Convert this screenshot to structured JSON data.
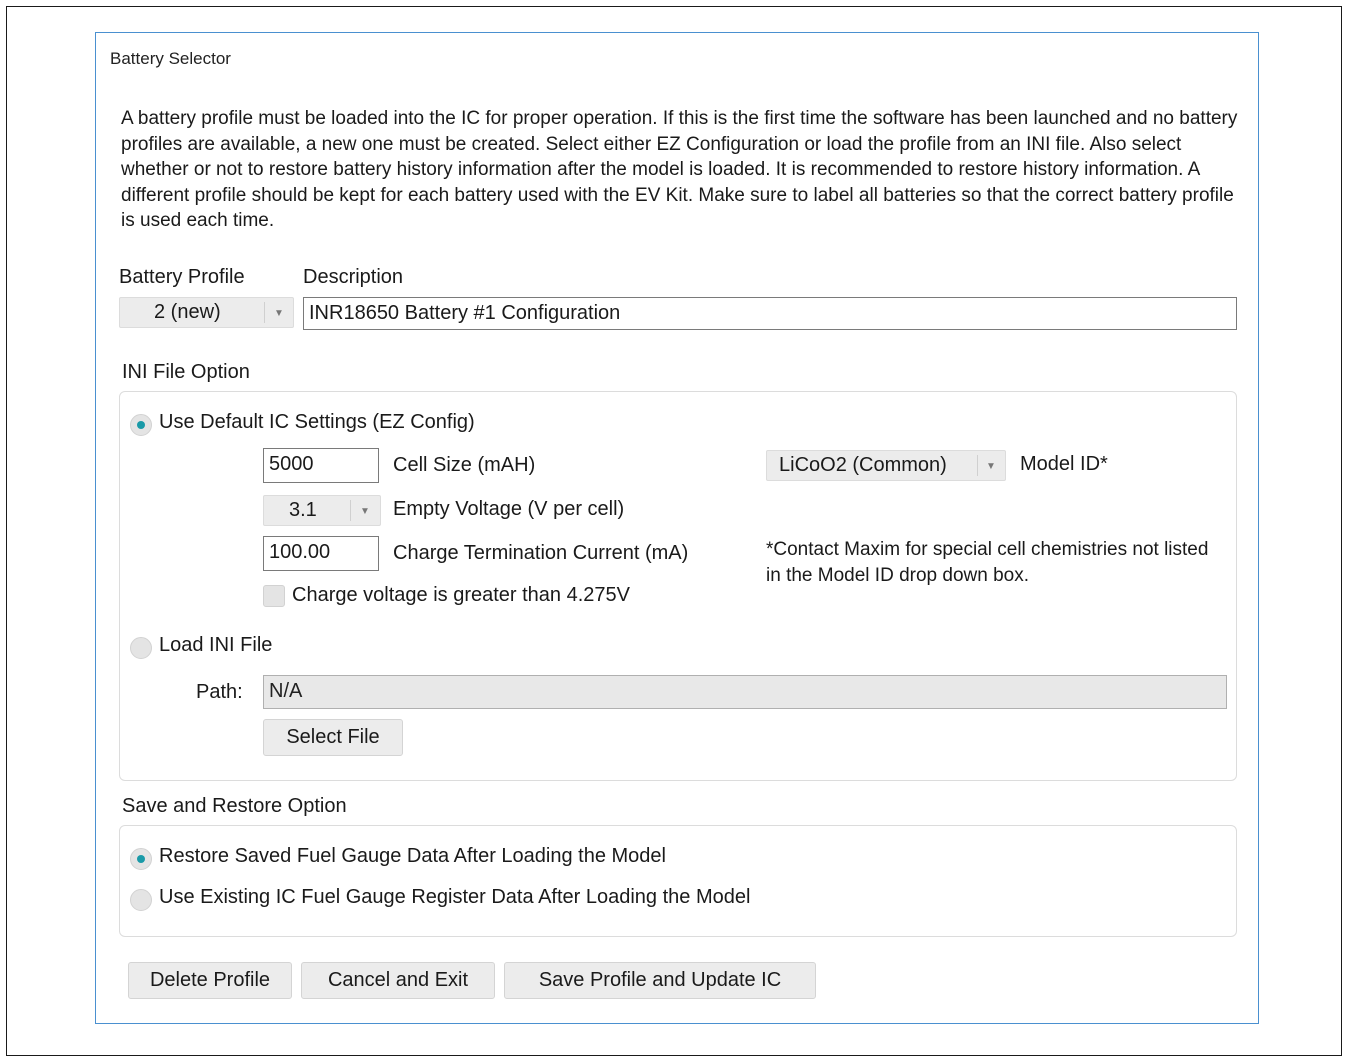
{
  "window": {
    "title": "Battery Selector"
  },
  "intro": "A battery profile must be loaded into the IC for proper operation. If this is the first time the software has been launched and no battery profiles are available, a new one must be created. Select either EZ Configuration or load the profile from an INI file. Also select whether or not to restore battery history information after the model is loaded. It is recommended to restore history information. A different profile should be kept for each battery used with the EV Kit. Make sure to label all batteries so that the correct battery profile is used each time.",
  "profile": {
    "label": "Battery Profile",
    "selected": "2 (new)",
    "description_label": "Description",
    "description_value": "INR18650 Battery #1 Configuration"
  },
  "ini": {
    "section_label": "INI File Option",
    "use_default_label": "Use Default IC Settings (EZ Config)",
    "use_default_selected": true,
    "cell_size_value": "5000",
    "cell_size_label": "Cell Size (mAH)",
    "empty_voltage_value": "3.1",
    "empty_voltage_label": "Empty Voltage (V per cell)",
    "charge_term_value": "100.00",
    "charge_term_label": "Charge Termination Current (mA)",
    "charge_voltage_check_label": "Charge voltage is greater than 4.275V",
    "charge_voltage_checked": false,
    "model_id_value": "LiCoO2 (Common)",
    "model_id_label": "Model ID*",
    "note": "*Contact Maxim for special cell chemistries not listed in the Model ID drop down box.",
    "load_ini_label": "Load INI File",
    "load_ini_selected": false,
    "path_label": "Path:",
    "path_value": "N/A",
    "select_file_label": "Select File"
  },
  "restore": {
    "section_label": "Save and Restore Option",
    "restore_saved_label": "Restore Saved Fuel Gauge Data After Loading the Model",
    "restore_saved_selected": true,
    "use_existing_label": "Use Existing IC Fuel Gauge Register Data After Loading the Model",
    "use_existing_selected": false
  },
  "buttons": {
    "delete": "Delete Profile",
    "cancel": "Cancel and Exit",
    "save": "Save Profile and Update IC"
  },
  "colors": {
    "accent": "#1a9aa8",
    "dialog_border": "#4a90d0"
  },
  "icons": {
    "dropdown": "chevron-down-icon"
  }
}
